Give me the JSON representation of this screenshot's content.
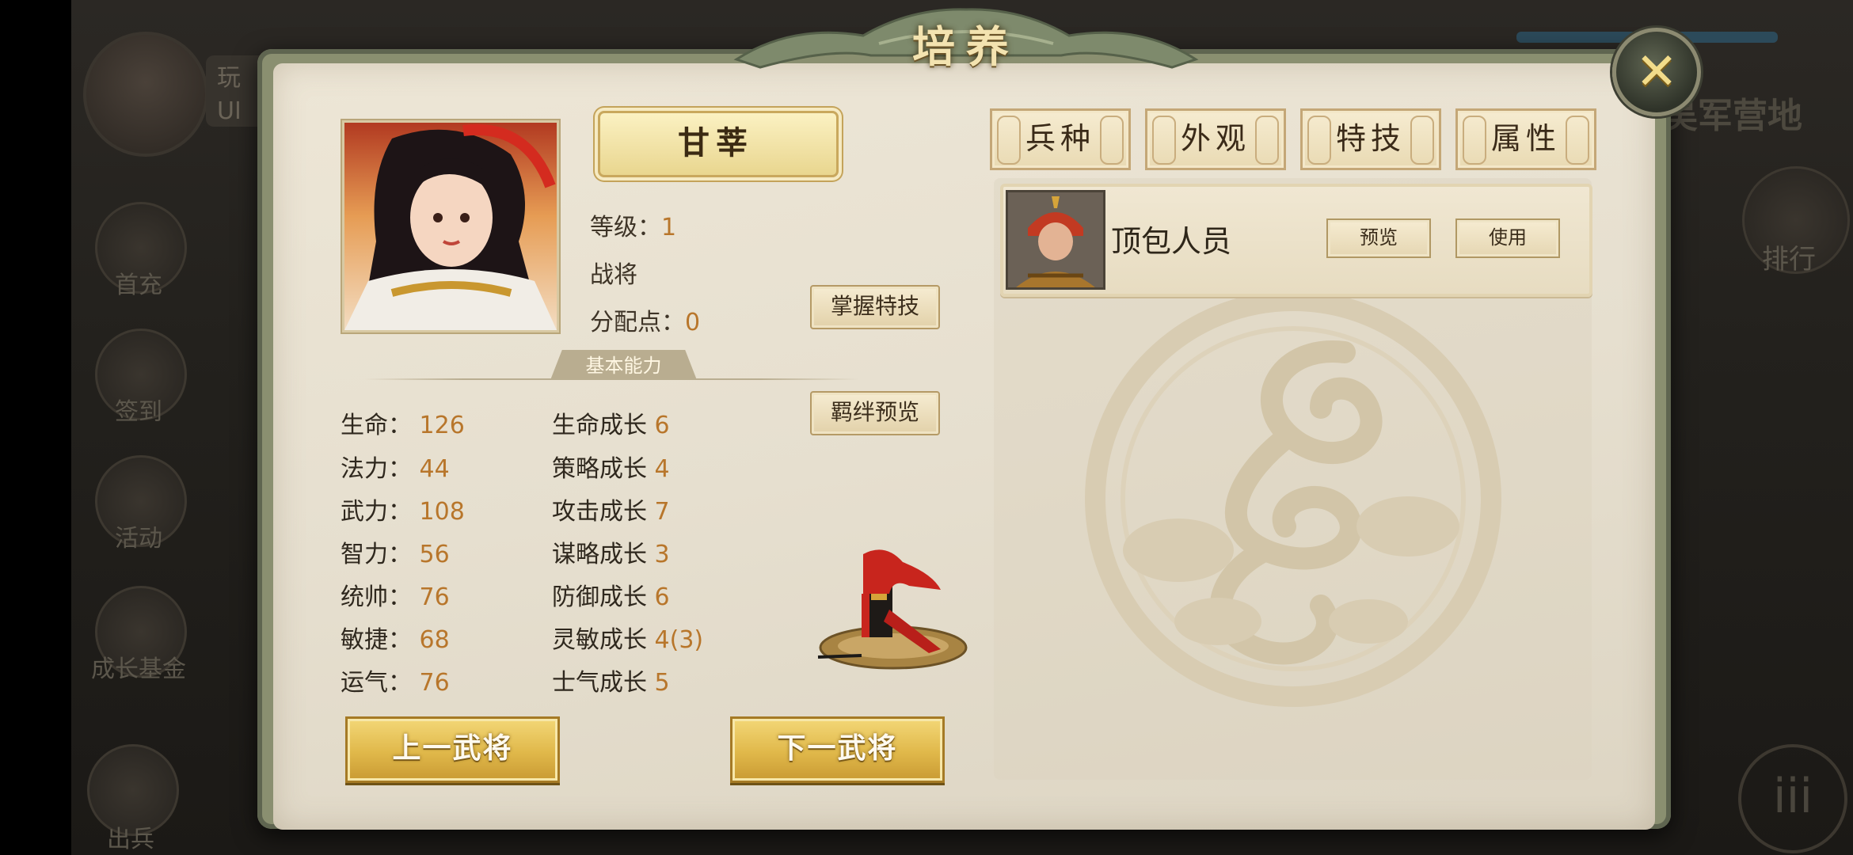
{
  "background": {
    "uid_text": "玩\nUI",
    "left_icons": [
      "首充",
      "签到",
      "活动",
      "成长基金",
      "出兵"
    ],
    "right_title": "吴军营地",
    "right_icon_label": "排行"
  },
  "dialog": {
    "title": "培养",
    "general_name": "甘莘",
    "level_label": "等级：",
    "level_value": "1",
    "role": "战将",
    "points_label": "分配点：",
    "points_value": "0",
    "master_skill_button": "掌握特技",
    "bond_preview_button": "羁绊预览",
    "section_label": "基本能力",
    "stats": [
      {
        "label": "生命：",
        "value": "126"
      },
      {
        "label": "法力：",
        "value": "44"
      },
      {
        "label": "武力：",
        "value": "108"
      },
      {
        "label": "智力：",
        "value": "56"
      },
      {
        "label": "统帅：",
        "value": "76"
      },
      {
        "label": "敏捷：",
        "value": "68"
      },
      {
        "label": "运气：",
        "value": "76"
      }
    ],
    "growth": [
      {
        "label": "生命成长",
        "value": "6"
      },
      {
        "label": "策略成长",
        "value": "4"
      },
      {
        "label": "攻击成长",
        "value": "7"
      },
      {
        "label": "谋略成长",
        "value": "3"
      },
      {
        "label": "防御成长",
        "value": "6"
      },
      {
        "label": "灵敏成长",
        "value": "4(3)"
      },
      {
        "label": "士气成长",
        "value": "5"
      }
    ],
    "prev_button": "上一武将",
    "next_button": "下一武将",
    "tabs": [
      "兵种",
      "外观",
      "特技",
      "属性"
    ],
    "troop": {
      "name": "顶包人员",
      "preview_button": "预览",
      "use_button": "使用"
    }
  },
  "colors": {
    "panel": "#e9e2d2",
    "value_orange": "#b8762b",
    "gold_button": "#e0b84a",
    "frame_green": "#8a8f70"
  },
  "icons": {
    "close": "close-x-icon",
    "dragon": "dragon-emblem-icon"
  }
}
